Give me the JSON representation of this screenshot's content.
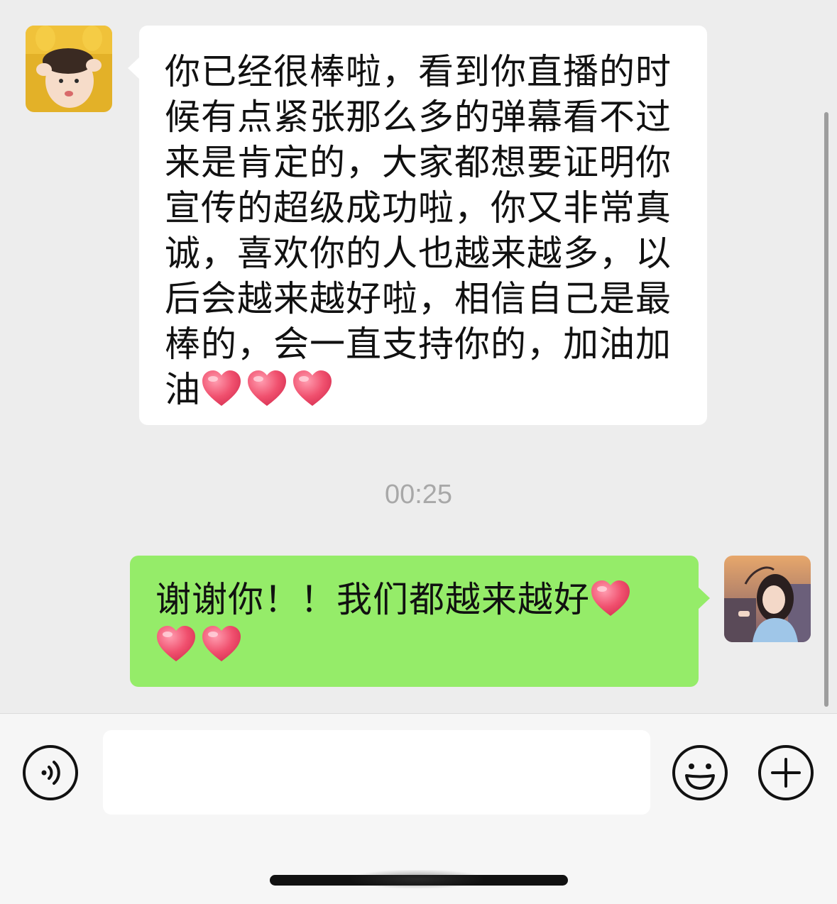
{
  "conversation": {
    "incoming_message": {
      "text": "你已经很棒啦，看到你直播的时候有点紧张那么多的弹幕看不过来是肯定的，大家都想要证明你宣传的超级成功啦，你又非常真诚，喜欢你的人也越来越多，以后会越来越好啦，相信自己是最棒的，会一直支持你的，加油加油",
      "emoji": [
        "heart",
        "heart",
        "heart"
      ]
    },
    "timestamp": "00:25",
    "outgoing_message": {
      "text": "谢谢你！！我们都越来越好",
      "emoji": [
        "heart",
        "heart",
        "heart"
      ]
    }
  },
  "input_bar": {
    "text_value": "",
    "voice_icon": "voice-icon",
    "emoji_icon": "smiley-icon",
    "plus_icon": "plus-icon"
  },
  "colors": {
    "chat_background": "#ededed",
    "incoming_bubble": "#ffffff",
    "outgoing_bubble": "#95ec69",
    "heart": "#f0506e",
    "timestamp": "#a8a8a8"
  }
}
